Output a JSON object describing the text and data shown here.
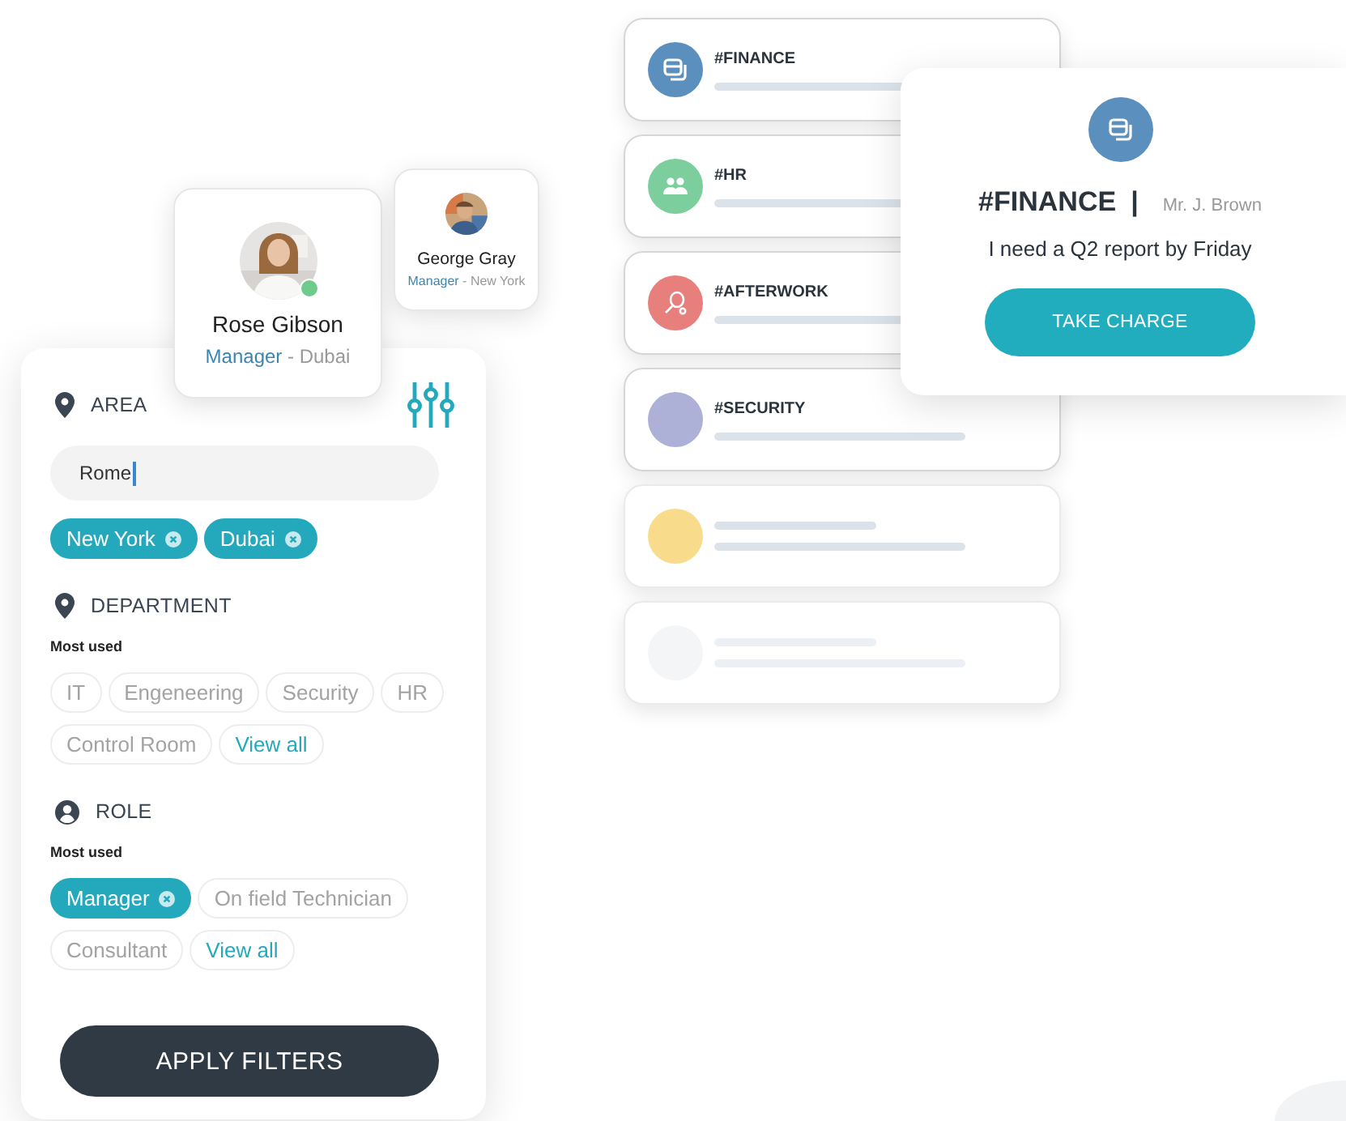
{
  "profile_cards": [
    {
      "name": "Rose Gibson",
      "role": "Manager",
      "separator": "-",
      "location": "Dubai",
      "online": true
    },
    {
      "name": "George Gray",
      "role": "Manager",
      "separator": "-",
      "location": "New York",
      "online": false
    }
  ],
  "filters": {
    "sections": [
      {
        "title": "AREA",
        "field": {
          "value": "Rome",
          "focused": true
        },
        "tags": [
          {
            "label": "New York",
            "kind": "tag",
            "selected": true
          },
          {
            "label": "Dubai",
            "kind": "tag",
            "selected": true
          }
        ]
      },
      {
        "title": "DEPARTMENT",
        "subtitle": "Most used",
        "tags": [
          {
            "label": "IT",
            "kind": "tag",
            "selected": false
          },
          {
            "label": "Engeneering",
            "kind": "tag",
            "selected": false
          },
          {
            "label": "Security",
            "kind": "tag",
            "selected": false
          },
          {
            "label": "HR",
            "kind": "tag",
            "selected": false
          },
          {
            "label": "Control Room",
            "kind": "tag",
            "selected": false
          },
          {
            "label": "View all",
            "kind": "link"
          }
        ]
      },
      {
        "title": "ROLE",
        "subtitle": "Most used",
        "tags": [
          {
            "label": "Manager",
            "kind": "tag",
            "selected": true
          },
          {
            "label": "On field Technician",
            "kind": "tag",
            "selected": false
          },
          {
            "label": "Consultant",
            "kind": "tag",
            "selected": false
          },
          {
            "label": "View all",
            "kind": "link"
          }
        ]
      }
    ],
    "apply_button": "APPLY FILTERS"
  },
  "channels": [
    {
      "title": "#FINANCE",
      "color": "#5b8fbd"
    },
    {
      "title": "#HR",
      "color": "#7ccf9c"
    },
    {
      "title": "#AFTERWORK",
      "color": "#e77f7d"
    },
    {
      "title": "#SECURITY",
      "color": "#adb1d8"
    },
    {
      "color": "#f8dc8c"
    },
    {
      "color": "#f4f5f7"
    }
  ],
  "message_card": {
    "channel": "#FINANCE",
    "color": "#5b8fbd",
    "separator": "|",
    "sender": "Mr. J. Brown",
    "text": "I need a Q2 report by Friday",
    "button": "TAKE CHARGE"
  }
}
